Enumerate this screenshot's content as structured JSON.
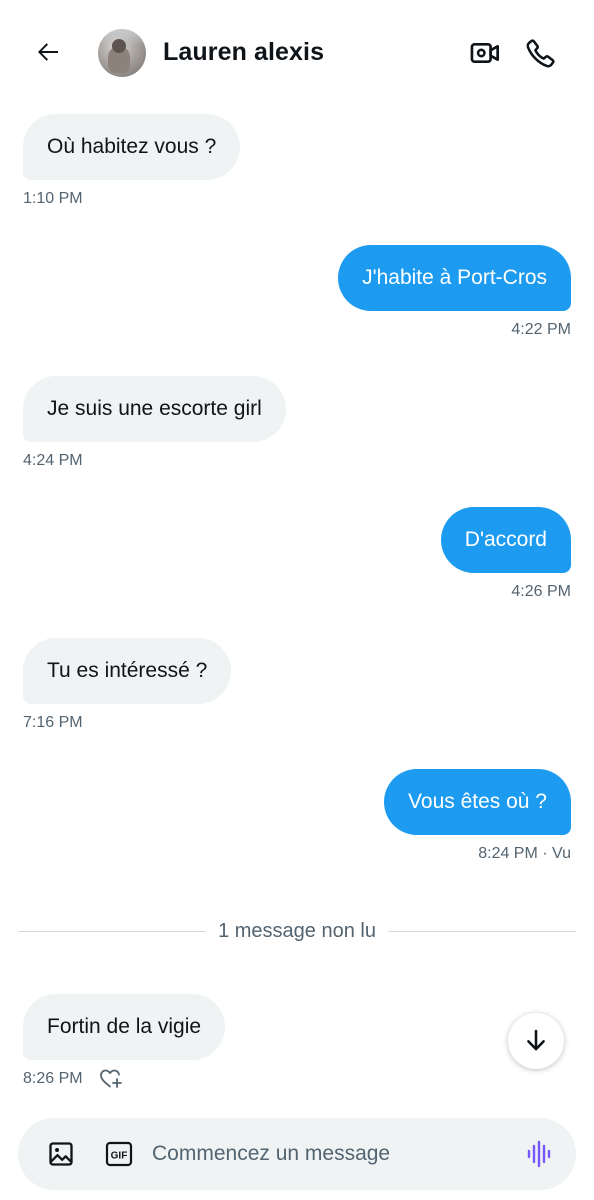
{
  "header": {
    "contact_name": "Lauren alexis"
  },
  "messages": [
    {
      "direction": "in",
      "text": "Où habitez vous ?",
      "time": "1:10 PM"
    },
    {
      "direction": "out",
      "text": "J'habite à Port-Cros",
      "time": "4:22 PM"
    },
    {
      "direction": "in",
      "text": "Je suis une escorte girl",
      "time": "4:24 PM"
    },
    {
      "direction": "out",
      "text": "D'accord",
      "time": "4:26 PM"
    },
    {
      "direction": "in",
      "text": "Tu es intéressé ?",
      "time": "7:16 PM"
    },
    {
      "direction": "out",
      "text": "Vous êtes où ?",
      "time": "8:24 PM · Vu"
    },
    {
      "direction": "in",
      "text": "Fortin de la vigie",
      "time": "8:26 PM"
    }
  ],
  "unread_divider": "1 message non lu",
  "composer": {
    "placeholder": "Commencez un message",
    "gif_label": "GIF"
  },
  "icons": {
    "back": "arrow-left-icon",
    "video": "video-camera-icon",
    "call": "phone-icon",
    "like": "heart-plus-icon",
    "scroll": "arrow-down-icon",
    "media": "image-icon",
    "gif": "gif-icon",
    "voice": "voice-waveform-icon"
  },
  "colors": {
    "accent": "#1d9bf0",
    "incoming_bubble": "#eff3f4",
    "secondary_text": "#536471",
    "voice_icon": "#7856ff"
  }
}
